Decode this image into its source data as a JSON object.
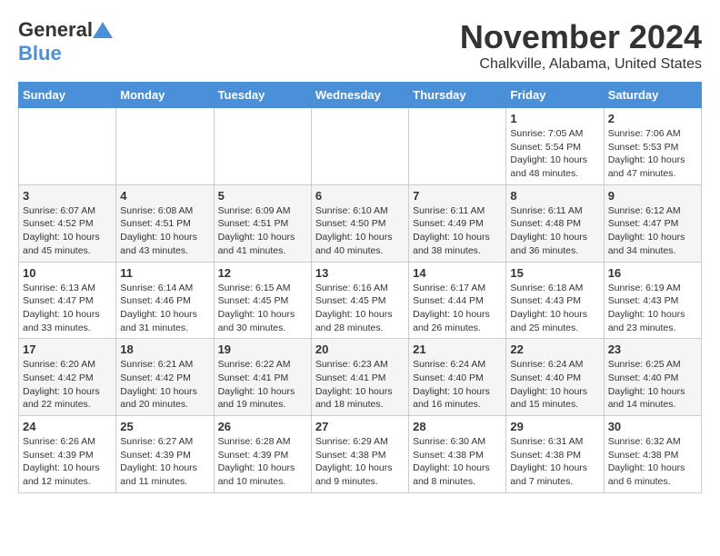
{
  "logo": {
    "line1": "General",
    "line2": "Blue"
  },
  "title": "November 2024",
  "subtitle": "Chalkville, Alabama, United States",
  "weekdays": [
    "Sunday",
    "Monday",
    "Tuesday",
    "Wednesday",
    "Thursday",
    "Friday",
    "Saturday"
  ],
  "weeks": [
    [
      {
        "day": "",
        "info": ""
      },
      {
        "day": "",
        "info": ""
      },
      {
        "day": "",
        "info": ""
      },
      {
        "day": "",
        "info": ""
      },
      {
        "day": "",
        "info": ""
      },
      {
        "day": "1",
        "info": "Sunrise: 7:05 AM\nSunset: 5:54 PM\nDaylight: 10 hours\nand 48 minutes."
      },
      {
        "day": "2",
        "info": "Sunrise: 7:06 AM\nSunset: 5:53 PM\nDaylight: 10 hours\nand 47 minutes."
      }
    ],
    [
      {
        "day": "3",
        "info": "Sunrise: 6:07 AM\nSunset: 4:52 PM\nDaylight: 10 hours\nand 45 minutes."
      },
      {
        "day": "4",
        "info": "Sunrise: 6:08 AM\nSunset: 4:51 PM\nDaylight: 10 hours\nand 43 minutes."
      },
      {
        "day": "5",
        "info": "Sunrise: 6:09 AM\nSunset: 4:51 PM\nDaylight: 10 hours\nand 41 minutes."
      },
      {
        "day": "6",
        "info": "Sunrise: 6:10 AM\nSunset: 4:50 PM\nDaylight: 10 hours\nand 40 minutes."
      },
      {
        "day": "7",
        "info": "Sunrise: 6:11 AM\nSunset: 4:49 PM\nDaylight: 10 hours\nand 38 minutes."
      },
      {
        "day": "8",
        "info": "Sunrise: 6:11 AM\nSunset: 4:48 PM\nDaylight: 10 hours\nand 36 minutes."
      },
      {
        "day": "9",
        "info": "Sunrise: 6:12 AM\nSunset: 4:47 PM\nDaylight: 10 hours\nand 34 minutes."
      }
    ],
    [
      {
        "day": "10",
        "info": "Sunrise: 6:13 AM\nSunset: 4:47 PM\nDaylight: 10 hours\nand 33 minutes."
      },
      {
        "day": "11",
        "info": "Sunrise: 6:14 AM\nSunset: 4:46 PM\nDaylight: 10 hours\nand 31 minutes."
      },
      {
        "day": "12",
        "info": "Sunrise: 6:15 AM\nSunset: 4:45 PM\nDaylight: 10 hours\nand 30 minutes."
      },
      {
        "day": "13",
        "info": "Sunrise: 6:16 AM\nSunset: 4:45 PM\nDaylight: 10 hours\nand 28 minutes."
      },
      {
        "day": "14",
        "info": "Sunrise: 6:17 AM\nSunset: 4:44 PM\nDaylight: 10 hours\nand 26 minutes."
      },
      {
        "day": "15",
        "info": "Sunrise: 6:18 AM\nSunset: 4:43 PM\nDaylight: 10 hours\nand 25 minutes."
      },
      {
        "day": "16",
        "info": "Sunrise: 6:19 AM\nSunset: 4:43 PM\nDaylight: 10 hours\nand 23 minutes."
      }
    ],
    [
      {
        "day": "17",
        "info": "Sunrise: 6:20 AM\nSunset: 4:42 PM\nDaylight: 10 hours\nand 22 minutes."
      },
      {
        "day": "18",
        "info": "Sunrise: 6:21 AM\nSunset: 4:42 PM\nDaylight: 10 hours\nand 20 minutes."
      },
      {
        "day": "19",
        "info": "Sunrise: 6:22 AM\nSunset: 4:41 PM\nDaylight: 10 hours\nand 19 minutes."
      },
      {
        "day": "20",
        "info": "Sunrise: 6:23 AM\nSunset: 4:41 PM\nDaylight: 10 hours\nand 18 minutes."
      },
      {
        "day": "21",
        "info": "Sunrise: 6:24 AM\nSunset: 4:40 PM\nDaylight: 10 hours\nand 16 minutes."
      },
      {
        "day": "22",
        "info": "Sunrise: 6:24 AM\nSunset: 4:40 PM\nDaylight: 10 hours\nand 15 minutes."
      },
      {
        "day": "23",
        "info": "Sunrise: 6:25 AM\nSunset: 4:40 PM\nDaylight: 10 hours\nand 14 minutes."
      }
    ],
    [
      {
        "day": "24",
        "info": "Sunrise: 6:26 AM\nSunset: 4:39 PM\nDaylight: 10 hours\nand 12 minutes."
      },
      {
        "day": "25",
        "info": "Sunrise: 6:27 AM\nSunset: 4:39 PM\nDaylight: 10 hours\nand 11 minutes."
      },
      {
        "day": "26",
        "info": "Sunrise: 6:28 AM\nSunset: 4:39 PM\nDaylight: 10 hours\nand 10 minutes."
      },
      {
        "day": "27",
        "info": "Sunrise: 6:29 AM\nSunset: 4:38 PM\nDaylight: 10 hours\nand 9 minutes."
      },
      {
        "day": "28",
        "info": "Sunrise: 6:30 AM\nSunset: 4:38 PM\nDaylight: 10 hours\nand 8 minutes."
      },
      {
        "day": "29",
        "info": "Sunrise: 6:31 AM\nSunset: 4:38 PM\nDaylight: 10 hours\nand 7 minutes."
      },
      {
        "day": "30",
        "info": "Sunrise: 6:32 AM\nSunset: 4:38 PM\nDaylight: 10 hours\nand 6 minutes."
      }
    ]
  ]
}
